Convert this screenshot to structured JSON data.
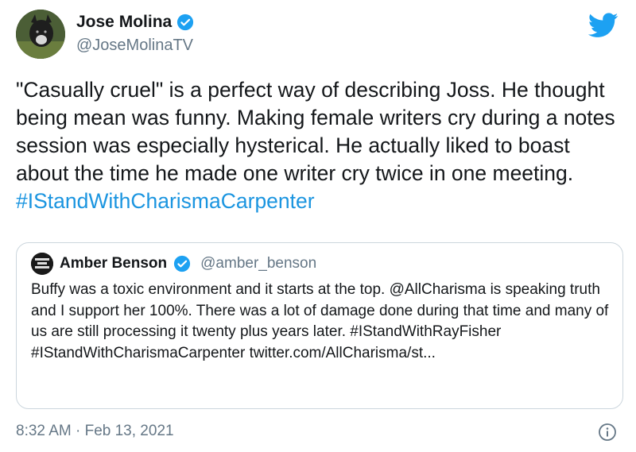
{
  "tweet": {
    "author_name": "Jose Molina",
    "author_handle": "@JoseMolinaTV",
    "text_main": "\"Casually cruel\" is a perfect way of describing Joss. He thought being mean was funny. Making female writers cry during a notes session was especially hysterical. He actually liked to boast about the time he made one writer cry twice in one meeting. ",
    "hashtag": "#IStandWithCharismaCarpenter",
    "timestamp": "8:32 AM · Feb 13, 2021"
  },
  "quote": {
    "author_name": "Amber Benson",
    "author_handle": "@amber_benson",
    "text": "Buffy was a toxic environment and it starts at the top. @AllCharisma is speaking truth and I support her 100%. There was a lot of damage done during that time and many of us are still processing it twenty plus years later. #IStandWithRayFisher #IStandWithCharismaCarpenter twitter.com/AllCharisma/st..."
  },
  "icons": {
    "bird": "twitter-bird-icon",
    "verified": "verified-badge-icon",
    "info": "info-icon"
  },
  "colors": {
    "link": "#1b95e0",
    "muted": "#657786",
    "border": "#ccd6dd",
    "verified": "#1da1f2"
  }
}
